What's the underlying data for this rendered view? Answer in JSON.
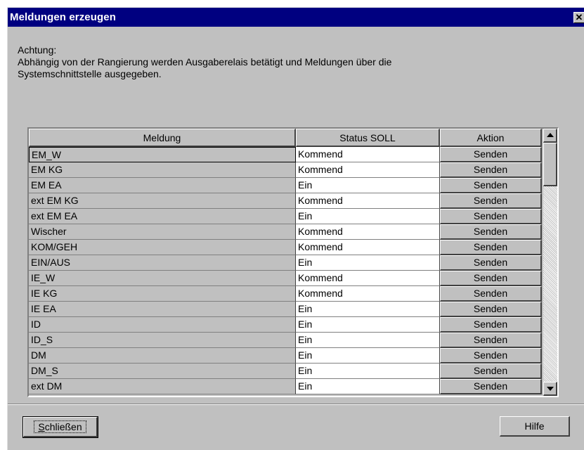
{
  "window": {
    "title": "Meldungen erzeugen",
    "close_label": "✕"
  },
  "notice": {
    "heading": "Achtung:",
    "line1": "Abhängig von der Rangierung werden  Ausgaberelais betätigt und Meldungen über die",
    "line2": "Systemschnittstelle ausgegeben."
  },
  "table": {
    "columns": [
      "Meldung",
      "Status SOLL",
      "Aktion"
    ],
    "rows": [
      {
        "meldung": "EM_W",
        "status": "Kommend",
        "aktion": "Senden"
      },
      {
        "meldung": "EM KG",
        "status": "Kommend",
        "aktion": "Senden"
      },
      {
        "meldung": "EM EA",
        "status": "Ein",
        "aktion": "Senden"
      },
      {
        "meldung": "ext EM KG",
        "status": "Kommend",
        "aktion": "Senden"
      },
      {
        "meldung": "ext EM EA",
        "status": "Ein",
        "aktion": "Senden"
      },
      {
        "meldung": "Wischer",
        "status": "Kommend",
        "aktion": "Senden"
      },
      {
        "meldung": "KOM/GEH",
        "status": "Kommend",
        "aktion": "Senden"
      },
      {
        "meldung": "EIN/AUS",
        "status": "Ein",
        "aktion": "Senden"
      },
      {
        "meldung": "IE_W",
        "status": "Kommend",
        "aktion": "Senden"
      },
      {
        "meldung": "IE KG",
        "status": "Kommend",
        "aktion": "Senden"
      },
      {
        "meldung": "IE EA",
        "status": "Ein",
        "aktion": "Senden"
      },
      {
        "meldung": "ID",
        "status": "Ein",
        "aktion": "Senden"
      },
      {
        "meldung": "ID_S",
        "status": "Ein",
        "aktion": "Senden"
      },
      {
        "meldung": "DM",
        "status": "Ein",
        "aktion": "Senden"
      },
      {
        "meldung": "DM_S",
        "status": "Ein",
        "aktion": "Senden"
      },
      {
        "meldung": "ext DM",
        "status": "Ein",
        "aktion": "Senden"
      }
    ]
  },
  "buttons": {
    "close_mnemonic": "S",
    "close_rest": "chließen",
    "help": "Hilfe"
  },
  "colors": {
    "titlebar": "#000080",
    "face": "#c0c0c0"
  }
}
